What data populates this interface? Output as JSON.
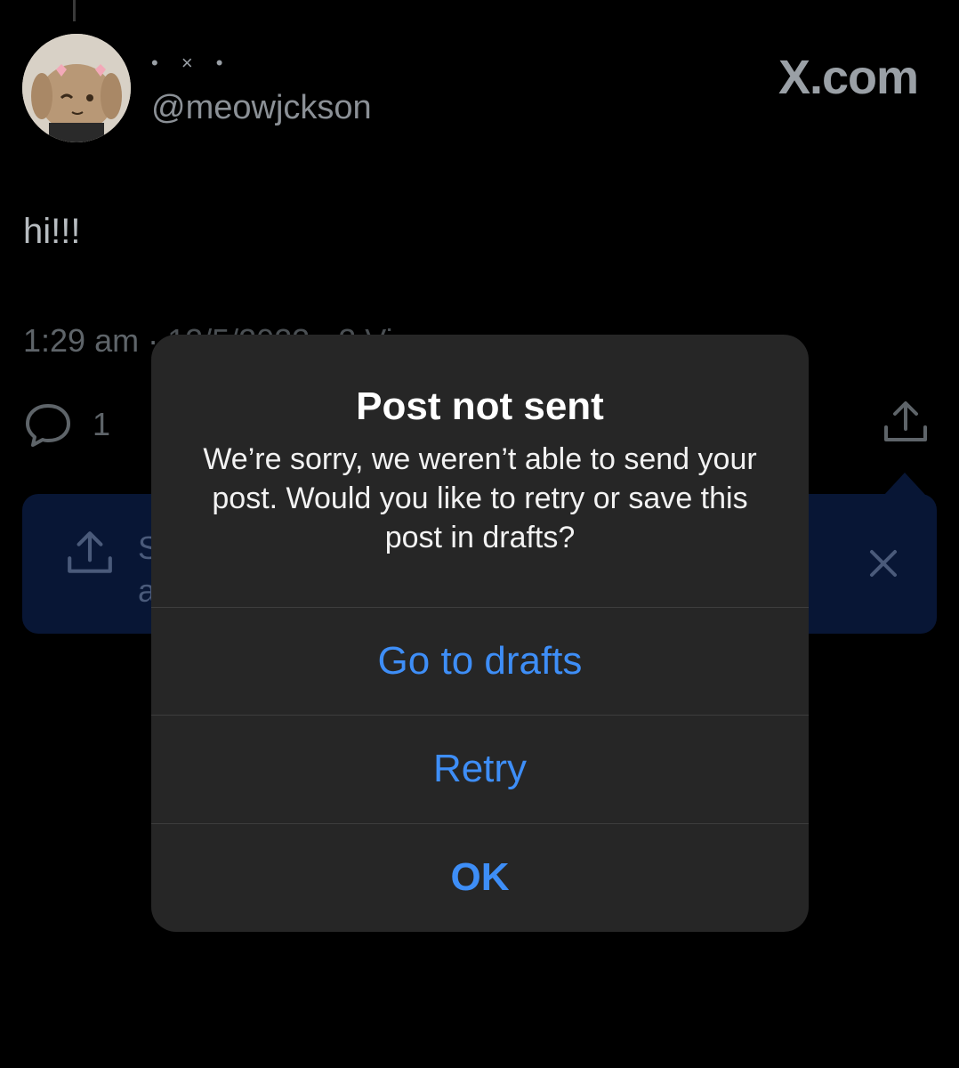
{
  "post": {
    "display_name": "• × •",
    "handle": "@meowjckson",
    "brand": "X.com",
    "text": "hi!!!",
    "time": "1:29 am",
    "separator": " · ",
    "date_partial": "12/5/2023 · 2 Vi",
    "reply_count": "1"
  },
  "banner": {
    "line1": "S",
    "line2": "a"
  },
  "alert": {
    "title": "Post not sent",
    "message": "We’re sorry, we weren’t able to send your post. Would you like to retry or save this post in drafts?",
    "buttons": {
      "drafts": "Go to drafts",
      "retry": "Retry",
      "ok": "OK"
    }
  },
  "colors": {
    "background": "#000000",
    "alert_background": "#262626",
    "button_text": "#3e8ef7",
    "banner_background": "#081635"
  },
  "icons": {
    "reply": "reply-bubble-icon",
    "share": "share-upload-icon",
    "close": "close-icon"
  }
}
